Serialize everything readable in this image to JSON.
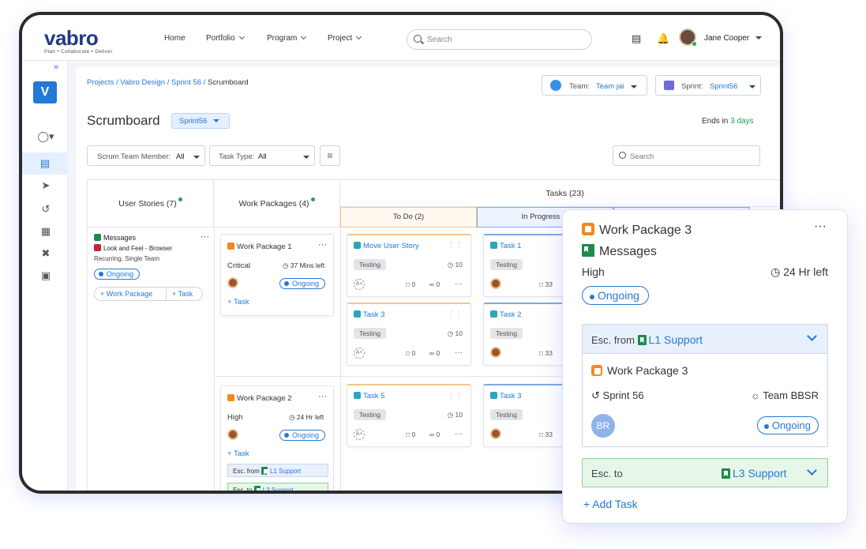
{
  "brand": {
    "name": "vabro",
    "tagline": "Plan • Collaborate • Deliver"
  },
  "nav": {
    "home": "Home",
    "portfolio": "Portfolio",
    "program": "Program",
    "project": "Project"
  },
  "search": {
    "placeholder": "Search"
  },
  "user": {
    "name": "Jane Cooper"
  },
  "sidebar": {
    "workspace_initial": "V"
  },
  "breadcrumb": {
    "path": "Projects / Vabro Design / Sprint 56 / ",
    "current": "Scrumboard"
  },
  "filters": {
    "team_label": "Team:",
    "team_value": "Team jai",
    "sprint_label": "Sprint:",
    "sprint_value": "Sprint56",
    "member": "Scrum Team Member:",
    "member_value": "All",
    "task_type": "Task Type:",
    "task_value": "All",
    "search_placeholder": "Search"
  },
  "page": {
    "title": "Scrumboard",
    "sprint_pill": "Sprint56",
    "ends_prefix": "Ends in",
    "ends_value": "3 days"
  },
  "columns": {
    "stories": "User Stories (7)",
    "packages": "Work Packages (4)",
    "tasks": "Tasks (23)",
    "todo": "To Do (2)",
    "inprogress": "In Progress (1"
  },
  "story": {
    "title": "Messages",
    "feature": "Look and Feel - Browser",
    "recurrence": "Recurring, Single Team",
    "status": "Ongoing",
    "add_wp": "+ Work Package",
    "add_task": "+ Task"
  },
  "wp1": {
    "title": "Work Package  1",
    "priority": "Critical",
    "time": "37 Mins left",
    "status": "Ongoing",
    "add_task": "+ Task"
  },
  "wp2": {
    "title": "Work Package  2",
    "priority": "High",
    "time": "24 Hr left",
    "status": "Ongoing",
    "add_task": "+ Task",
    "esc_from": "Esc. from",
    "esc_from_team": "L1 Support",
    "esc_to": "Esc. to",
    "esc_to_team": "L3 Support"
  },
  "todo_cards": [
    {
      "title": "Move User Story",
      "tag": "Testing",
      "points": "10",
      "comments": "0",
      "attachments": "0"
    },
    {
      "title": "Task 3",
      "tag": "Testing",
      "points": "10",
      "comments": "0",
      "attachments": "0"
    },
    {
      "title": "Task 5",
      "tag": "Testing",
      "points": "10",
      "comments": "0",
      "attachments": "0"
    }
  ],
  "progress_cards": [
    {
      "title": "Task 1",
      "tag": "Testing",
      "comments": "33"
    },
    {
      "title": "Task 2",
      "tag": "Testing",
      "comments": "33"
    },
    {
      "title": "Task 3",
      "tag": "Testing",
      "comments": "33"
    }
  ],
  "popup": {
    "title": "Work Package  3",
    "story": "Messages",
    "priority": "High",
    "time": "24 Hr left",
    "status": "Ongoing",
    "esc_from": "Esc. from",
    "esc_from_team": "L1 Support",
    "wp": "Work Package 3",
    "sprint": "Sprint 56",
    "team": "Team BBSR",
    "assignee_initials": "BR",
    "assignee_status": "Ongoing",
    "esc_to": "Esc. to",
    "esc_to_team": "L3 Support",
    "add_task": "+  Add Task"
  },
  "colors": {
    "accent": "#2479d6",
    "success": "#22a05a",
    "todo_border": "#f3c58a",
    "progress_border": "#7fa8e6"
  }
}
